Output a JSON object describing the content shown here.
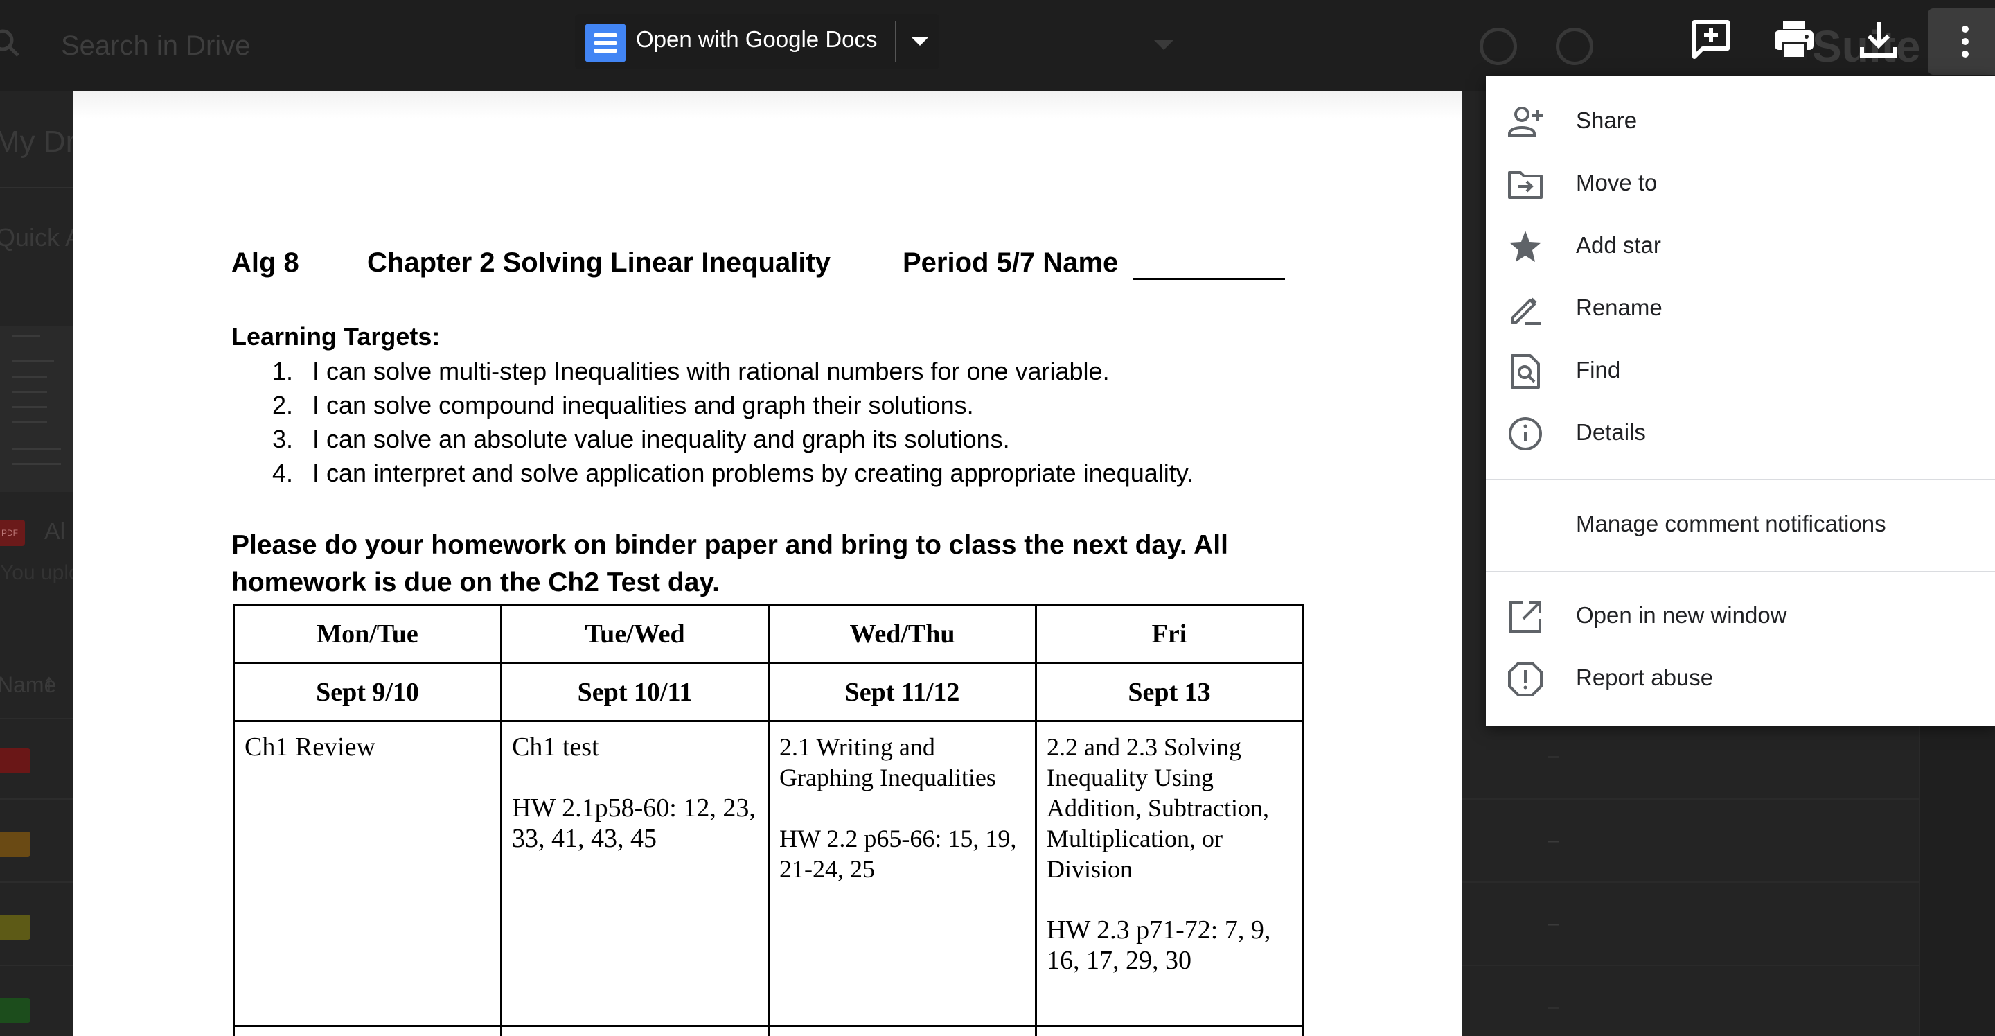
{
  "background": {
    "search_placeholder": "Search in Drive",
    "my_drive": "My Drive",
    "quick_access": "Quick Access",
    "file_name_partial": "Al",
    "uploaded_partial": "You uploaded",
    "name_column": "Name",
    "suite_partial": "Suite"
  },
  "toolbar": {
    "open_with_label": "Open with Google Docs"
  },
  "document": {
    "course": "Alg 8",
    "chapter": "Chapter 2  Solving Linear Inequality",
    "period_name": "Period 5/7  Name",
    "learning_targets_title": "Learning Targets:",
    "targets": [
      {
        "num": "1.",
        "text": "I can solve multi-step Inequalities with rational numbers for one variable."
      },
      {
        "num": "2.",
        "text": "I can solve compound inequalities and graph their solutions."
      },
      {
        "num": "3.",
        "text": "I can solve an absolute value inequality and graph its solutions."
      },
      {
        "num": "4.",
        "text": "I can interpret and solve application problems by creating appropriate inequality."
      }
    ],
    "homework_note_line1": "Please do your homework on binder paper and bring to class the next day. All",
    "homework_note_line2": "homework is due on the Ch2 Test day.",
    "table": {
      "days": [
        "Mon/Tue",
        "Tue/Wed",
        "Wed/Thu",
        "Fri"
      ],
      "dates": [
        "Sept 9/10",
        "Sept 10/11",
        "Sept 11/12",
        "Sept 13"
      ],
      "cells": [
        {
          "topic": "Ch1 Review",
          "hw": ""
        },
        {
          "topic": "Ch1 test",
          "hw": "HW 2.1p58-60: 12, 23, 33, 41, 43, 45"
        },
        {
          "topic": "2.1 Writing and Graphing Inequalities",
          "hw": "HW 2.2 p65-66: 15, 19, 21-24, 25"
        },
        {
          "topic": "2.2 and 2.3 Solving Inequality Using Addition, Subtraction, Multiplication, or Division",
          "hw": "HW 2.3 p71-72: 7, 9, 16, 17, 29, 30"
        }
      ]
    }
  },
  "menu": {
    "items": [
      {
        "label": "Share",
        "icon": "person-add-icon"
      },
      {
        "label": "Move to",
        "icon": "move-to-folder-icon"
      },
      {
        "label": "Add star",
        "icon": "star-icon"
      },
      {
        "label": "Rename",
        "icon": "pencil-icon"
      },
      {
        "label": "Find",
        "icon": "find-in-page-icon"
      },
      {
        "label": "Details",
        "icon": "info-icon"
      }
    ],
    "manage_notifications": "Manage comment notifications",
    "open_new_window": "Open in new window",
    "report_abuse": "Report abuse"
  },
  "colors": {
    "docs_blue": "#4285f4",
    "menu_bg": "#ffffff",
    "overlay_bg": "#242424"
  }
}
